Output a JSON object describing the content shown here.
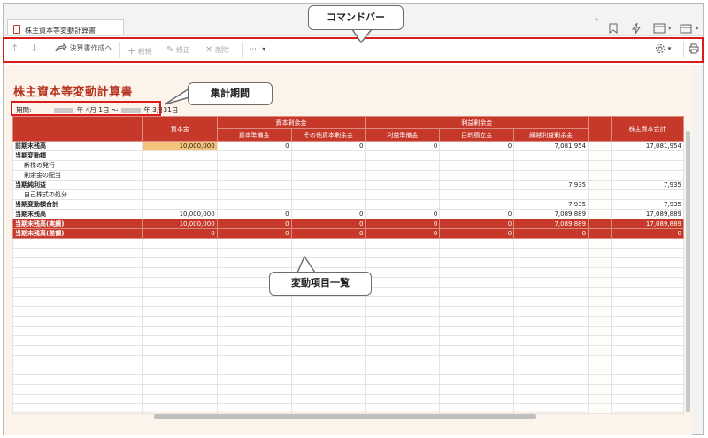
{
  "window": {
    "tab_title": "株主資本等変動計算書"
  },
  "toolbar": {
    "up_icon": "↑",
    "down_icon": "↓",
    "create_statement": "決算書作成へ",
    "new": "新規",
    "edit": "修正",
    "delete": "削除",
    "more": "···"
  },
  "page": {
    "title": "株主資本等変動計算書",
    "period_label": "期間:",
    "period_start": "年 4月 1日 ～",
    "period_end": "年 3月31日"
  },
  "table": {
    "headers": {
      "capital": "資本金",
      "capital_surplus": "資本剰余金",
      "capital_reserve": "資本準備金",
      "other_capital_surplus": "その他資本剰余金",
      "retained_earnings": "利益剰余金",
      "legal_reserve": "利益準備金",
      "special_reserve": "目的積立金",
      "retained_carried_forward": "繰越利益剰余金",
      "total": "株主資本合計"
    },
    "rows": [
      {
        "label": "前期末残高",
        "values": [
          "10,000,000",
          "0",
          "0",
          "0",
          "0",
          "7,081,954",
          "",
          "17,081,954"
        ]
      },
      {
        "label": "当期変動額",
        "values": [
          "",
          "",
          "",
          "",
          "",
          "",
          "",
          ""
        ]
      },
      {
        "label": "新株の発行",
        "values": [
          "",
          "",
          "",
          "",
          "",
          "",
          "",
          ""
        ]
      },
      {
        "label": "剰余金の配当",
        "values": [
          "",
          "",
          "",
          "",
          "",
          "",
          "",
          ""
        ]
      },
      {
        "label": "当期純利益",
        "values": [
          "",
          "",
          "",
          "",
          "",
          "7,935",
          "",
          "7,935"
        ]
      },
      {
        "label": "自己株式の処分",
        "values": [
          "",
          "",
          "",
          "",
          "",
          "",
          "",
          ""
        ]
      },
      {
        "label": "当期変動額合計",
        "values": [
          "",
          "",
          "",
          "",
          "",
          "7,935",
          "",
          "7,935"
        ]
      },
      {
        "label": "当期末残高",
        "values": [
          "10,000,000",
          "0",
          "0",
          "0",
          "0",
          "7,089,889",
          "",
          "17,089,889"
        ]
      },
      {
        "label": "当期末残高(実績)",
        "values": [
          "10,000,000",
          "0",
          "0",
          "0",
          "0",
          "7,089,889",
          "",
          "17,089,889"
        ]
      },
      {
        "label": "当期末残高(差額)",
        "values": [
          "0",
          "0",
          "0",
          "0",
          "0",
          "0",
          "",
          "0"
        ]
      }
    ]
  },
  "callouts": {
    "command_bar": "コマンドバー",
    "period": "集計期間",
    "items": "変動項目一覧"
  }
}
